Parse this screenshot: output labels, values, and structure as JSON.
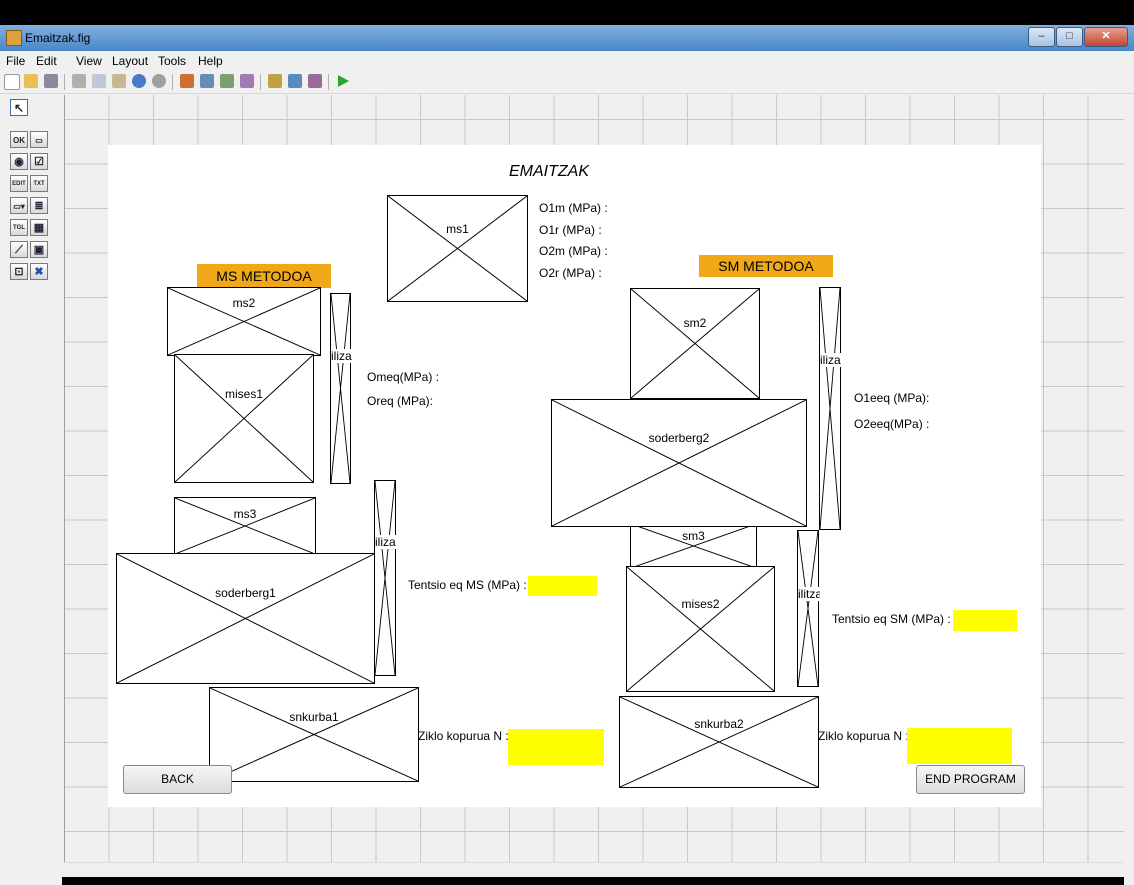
{
  "window": {
    "title": "Emaitzak.fig",
    "controls": {
      "minimize": "–",
      "maximize": "□",
      "close": "✕"
    }
  },
  "menu": [
    "File",
    "Edit",
    "View",
    "Layout",
    "Tools",
    "Help"
  ],
  "toolbar": {
    "icons": [
      "new-icon",
      "open-icon",
      "save-icon",
      "cut-icon",
      "copy-icon",
      "paste-icon",
      "undo-icon",
      "redo-icon",
      "align-icon",
      "menu-editor-icon",
      "tab-order-icon",
      "toolbar-editor-icon",
      "editor-icon",
      "property-inspector-icon",
      "object-browser-icon",
      "run-icon"
    ]
  },
  "palette": {
    "items": [
      {
        "name": "select-tool",
        "text": "↖"
      },
      {
        "name": "pushbutton-tool",
        "text": "OK"
      },
      {
        "name": "slider-tool",
        "text": "▭"
      },
      {
        "name": "radiobutton-tool",
        "text": "◉"
      },
      {
        "name": "checkbox-tool",
        "text": "☑"
      },
      {
        "name": "edit-text-tool",
        "text": "EDIT"
      },
      {
        "name": "static-text-tool",
        "text": "TXT"
      },
      {
        "name": "popup-menu-tool",
        "text": "▭▾"
      },
      {
        "name": "listbox-tool",
        "text": "≣"
      },
      {
        "name": "toggle-tool",
        "text": "TGL"
      },
      {
        "name": "table-tool",
        "text": "▦"
      },
      {
        "name": "axes-tool",
        "text": "⟋"
      },
      {
        "name": "panel-tool",
        "text": "▣"
      },
      {
        "name": "buttongroup-tool",
        "text": "⊡"
      },
      {
        "name": "activex-tool",
        "text": "✖"
      }
    ]
  },
  "figure": {
    "title": "EMAITZAK",
    "ms_heading": "MS METODOA",
    "sm_heading": "SM METODOA",
    "labels": {
      "o1m": "O1m (MPa) :",
      "o1r": "O1r (MPa) :",
      "o2m": "O2m (MPa) :",
      "o2r": "O2r (MPa) :",
      "omeq": "Omeq(MPa) :",
      "oreq": "Oreq (MPa):",
      "o1eeq": "O1eeq (MPa):",
      "o2eeq": "O2eeq(MPa) :",
      "tentsio_ms": "Tentsio eq MS (MPa) :",
      "tentsio_sm": "Tentsio eq SM (MPa) :",
      "ziklo_ms": "Ziklo kopurua N :",
      "ziklo_sm": "Ziklo kopurua N :"
    },
    "axes": {
      "ms1": "ms1",
      "ms2": "ms2",
      "mises1": "mises1",
      "ms3": "ms3",
      "soderberg1": "soderberg1",
      "snkurba1": "snkurba1",
      "sm2": "sm2",
      "soderberg2": "soderberg2",
      "sm3": "sm3",
      "mises2": "mises2",
      "snkurba2": "snkurba2",
      "side_ms_top": "iliza",
      "side_ms_bottom": "iliza",
      "side_sm_top": "iliza",
      "side_sm_bottom": "ilitza"
    },
    "buttons": {
      "back": "BACK",
      "end": "END PROGRAM"
    },
    "colors": {
      "heading_bg": "#f0a818",
      "field_bg": "#ffff00"
    }
  }
}
